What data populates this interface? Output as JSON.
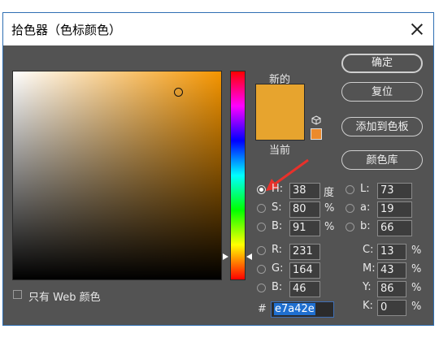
{
  "window": {
    "title": "拾色器（色标颜色）"
  },
  "swatch": {
    "new_label": "新的",
    "current_label": "当前",
    "new_color": "#e7a42e",
    "current_color": "#e7a42e"
  },
  "buttons": {
    "ok": "确定",
    "reset": "复位",
    "add_to_swatches": "添加到色板",
    "color_libraries": "颜色库"
  },
  "hsb": [
    {
      "label": "H:",
      "value": "38",
      "unit": "度",
      "selected": true
    },
    {
      "label": "S:",
      "value": "80",
      "unit": "%"
    },
    {
      "label": "B:",
      "value": "91",
      "unit": "%"
    }
  ],
  "rgb": [
    {
      "label": "R:",
      "value": "231"
    },
    {
      "label": "G:",
      "value": "164"
    },
    {
      "label": "B:",
      "value": "46"
    }
  ],
  "lab": [
    {
      "label": "L:",
      "value": "73"
    },
    {
      "label": "a:",
      "value": "19"
    },
    {
      "label": "b:",
      "value": "66"
    }
  ],
  "cmyk": [
    {
      "label": "C:",
      "value": "13",
      "unit": "%"
    },
    {
      "label": "M:",
      "value": "43",
      "unit": "%"
    },
    {
      "label": "Y:",
      "value": "86",
      "unit": "%"
    },
    {
      "label": "K:",
      "value": "0",
      "unit": "%"
    }
  ],
  "hex": {
    "prefix": "#",
    "value": "e7a42e"
  },
  "web_only": {
    "label": "只有 Web 颜色"
  }
}
